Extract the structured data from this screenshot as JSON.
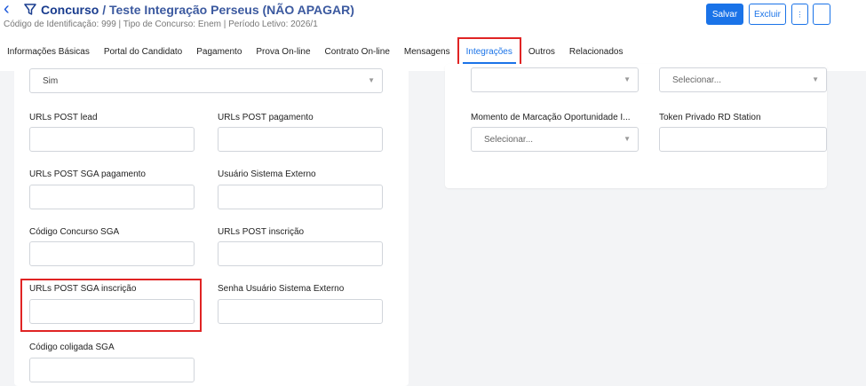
{
  "header": {
    "title_bold": "Concurso",
    "title_rest": " / Teste Integração Perseus (NÃO APAGAR)",
    "subtitle": "Código de Identificação: 999 | Tipo de Concurso: Enem | Período Letivo: 2026/1",
    "back_icon": "chevron-left-icon",
    "filter_icon": "filter-icon"
  },
  "toolbar": {
    "save_label": "Salvar",
    "delete_label": "Excluir",
    "more_label": "⋮"
  },
  "tabs": [
    {
      "label": "Informações Básicas"
    },
    {
      "label": "Portal do Candidato"
    },
    {
      "label": "Pagamento"
    },
    {
      "label": "Prova On-line"
    },
    {
      "label": "Contrato On-line"
    },
    {
      "label": "Mensagens"
    },
    {
      "label": "Integrações"
    },
    {
      "label": "Outros"
    },
    {
      "label": "Relacionados"
    }
  ],
  "left_form": {
    "top_select_value": "Sim",
    "fields": [
      {
        "label": "URLs POST lead"
      },
      {
        "label": "URLs POST pagamento"
      },
      {
        "label": "URLs POST SGA pagamento"
      },
      {
        "label": "Usuário Sistema Externo"
      },
      {
        "label": "Código Concurso SGA"
      },
      {
        "label": "URLs POST inscrição"
      },
      {
        "label": "URLs POST SGA inscrição"
      },
      {
        "label": "Senha Usuário Sistema Externo"
      },
      {
        "label": "Código coligada SGA"
      }
    ]
  },
  "right_form": {
    "select_top_right_placeholder": "Selecionar...",
    "momento_label": "Momento de Marcação Oportunidade I...",
    "momento_placeholder": "Selecionar...",
    "token_label": "Token Privado RD Station"
  },
  "colors": {
    "accent": "#1a73e8",
    "highlight": "#e02424"
  }
}
